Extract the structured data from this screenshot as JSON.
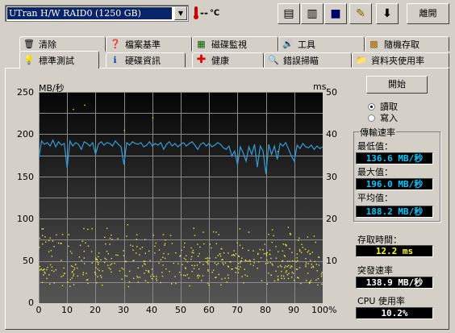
{
  "toolbar": {
    "drive": "UTran H/W RAID0 (1250 GB)",
    "temperature": "--",
    "temp_unit": "℃",
    "exit_label": "離開",
    "icons": [
      "copy-text-icon",
      "copy-image-icon",
      "save-icon",
      "options-icon",
      "down-arrow-icon"
    ]
  },
  "tabs": {
    "row1": [
      "清除",
      "檔案基準",
      "磁碟監視",
      "工具",
      "隨機存取"
    ],
    "row2": [
      "標準測試",
      "硬碟資訊",
      "健康",
      "錯誤掃瞄",
      "資料夾使用率"
    ],
    "active": "標準測試"
  },
  "controls": {
    "start_label": "開始",
    "read_label": "讀取",
    "write_label": "寫入",
    "selected_mode": "讀取"
  },
  "stats": {
    "transfer_rate_title": "傳輸速率",
    "min_label": "最低值：",
    "min_value": "136.6 MB/秒",
    "max_label": "最大值：",
    "max_value": "196.0 MB/秒",
    "avg_label": "平均值：",
    "avg_value": "188.2 MB/秒",
    "access_label": "存取時間：",
    "access_value": "12.2 ms",
    "burst_label": "突發速率",
    "burst_value": "138.9 MB/秒",
    "cpu_label": "CPU 使用率",
    "cpu_value": "10.2%"
  },
  "chart_data": {
    "type": "line",
    "y_left_unit": "MB/秒",
    "y_right_unit": "ms",
    "y_left_ticks": [
      250,
      200,
      150,
      100,
      50,
      0
    ],
    "y_right_ticks": [
      50,
      40,
      30,
      20,
      10
    ],
    "x_ticks": [
      "0",
      "10",
      "20",
      "30",
      "40",
      "50",
      "60",
      "70",
      "80",
      "90",
      "100%"
    ],
    "ylim_left": [
      0,
      250
    ],
    "ylim_right": [
      0,
      50
    ],
    "xlim": [
      0,
      100
    ],
    "grid": true,
    "transfer_series": {
      "name": "transfer rate",
      "color": "#2f9ed8",
      "x": [
        0,
        1,
        2,
        3,
        4,
        5,
        6,
        7,
        8,
        9,
        10,
        11,
        12,
        13,
        14,
        15,
        16,
        17,
        18,
        19,
        20,
        21,
        22,
        23,
        24,
        25,
        26,
        27,
        28,
        29,
        30,
        31,
        32,
        33,
        34,
        35,
        36,
        37,
        38,
        39,
        40,
        41,
        42,
        43,
        44,
        45,
        46,
        47,
        48,
        49,
        50,
        51,
        52,
        53,
        54,
        55,
        56,
        57,
        58,
        59,
        60,
        61,
        62,
        63,
        64,
        65,
        66,
        67,
        68,
        69,
        70,
        71,
        72,
        73,
        74,
        75,
        76,
        77,
        78,
        79,
        80,
        81,
        82,
        83,
        84,
        85,
        86,
        87,
        88,
        89,
        90,
        91,
        92,
        93,
        94,
        95,
        96,
        97,
        98,
        99,
        100
      ],
      "y": [
        170,
        192,
        188,
        190,
        186,
        193,
        185,
        191,
        187,
        189,
        160,
        192,
        186,
        190,
        188,
        182,
        191,
        189,
        186,
        190,
        176,
        188,
        191,
        187,
        190,
        189,
        186,
        192,
        188,
        185,
        164,
        190,
        187,
        191,
        189,
        188,
        190,
        185,
        187,
        191,
        186,
        189,
        187,
        190,
        182,
        188,
        191,
        186,
        189,
        185,
        188,
        190,
        186,
        189,
        191,
        187,
        182,
        188,
        190,
        186,
        189,
        185,
        187,
        190,
        188,
        184,
        182,
        186,
        174,
        180,
        164,
        185,
        178,
        168,
        185,
        176,
        188,
        161,
        186,
        180,
        153,
        188,
        176,
        186,
        170,
        189,
        186,
        190,
        182,
        174,
        168,
        187,
        183,
        189,
        185,
        184,
        187,
        182,
        186,
        183,
        185
      ]
    },
    "access_series": {
      "name": "access time",
      "color": "#e8e840",
      "approx_range_ms": [
        4,
        19
      ],
      "points": 500
    }
  }
}
